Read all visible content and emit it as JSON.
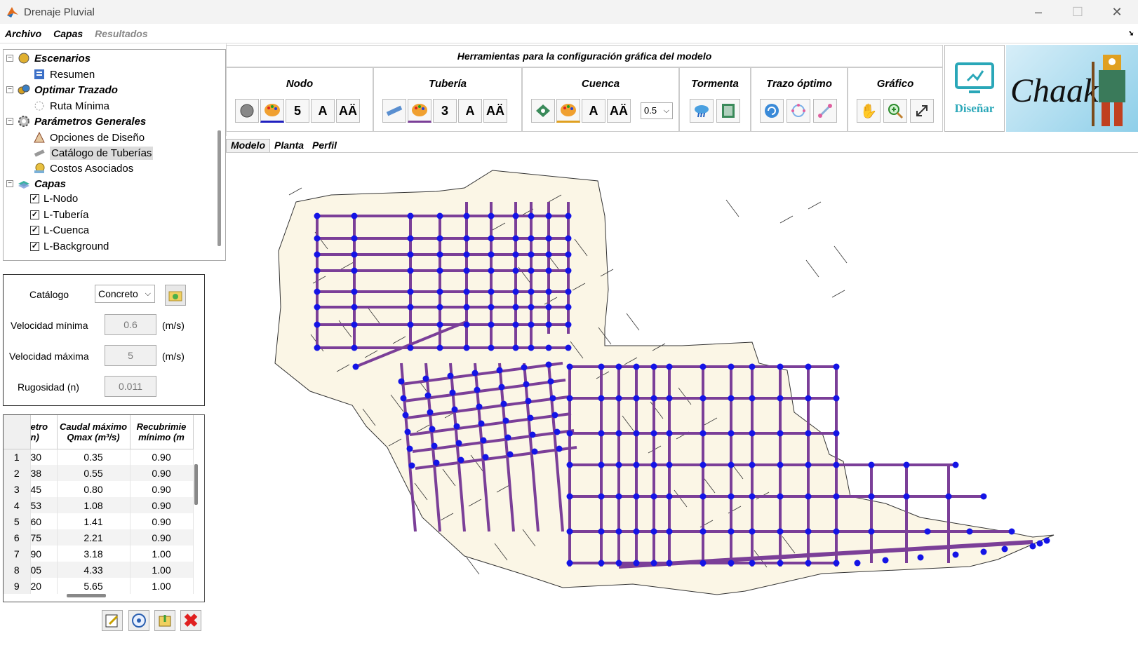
{
  "window": {
    "title": "Drenaje Pluvial",
    "minimize": "–",
    "maximize": "☐",
    "close": "✕"
  },
  "menu": [
    "Archivo",
    "Capas",
    "Resultados"
  ],
  "tree": {
    "escenarios": "Escenarios",
    "resumen": "Resumen",
    "optimar": "Optimar Trazado",
    "ruta": "Ruta Mínima",
    "parametros": "Parámetros Generales",
    "opciones": "Opciones de Diseño",
    "catalogo": "Catálogo de Tuberías",
    "costos": "Costos Asociados",
    "capas": "Capas",
    "layers": [
      {
        "label": "L-Nodo",
        "checked": true
      },
      {
        "label": "L-Tubería",
        "checked": true
      },
      {
        "label": "L-Cuenca",
        "checked": true
      },
      {
        "label": "L-Background",
        "checked": true
      }
    ]
  },
  "params": {
    "catalogo_label": "Catálogo",
    "catalogo_value": "Concreto",
    "vmin_label": "Velocidad mínima",
    "vmin_value": "0.6",
    "vmin_unit": "(m/s)",
    "vmax_label": "Velocidad máxima",
    "vmax_value": "5",
    "vmax_unit": "(m/s)",
    "rug_label": "Rugosidad (n)",
    "rug_value": "0.011"
  },
  "table": {
    "headers": [
      "etro\nn)",
      "Caudal máximo\nQmax (m³/s)",
      "Recubrimie\nmínimo (m"
    ],
    "rows": [
      [
        "1",
        "30",
        "0.35",
        "0.90"
      ],
      [
        "2",
        "38",
        "0.55",
        "0.90"
      ],
      [
        "3",
        "45",
        "0.80",
        "0.90"
      ],
      [
        "4",
        "53",
        "1.08",
        "0.90"
      ],
      [
        "5",
        "60",
        "1.41",
        "0.90"
      ],
      [
        "6",
        "75",
        "2.21",
        "0.90"
      ],
      [
        "7",
        "90",
        "3.18",
        "1.00"
      ],
      [
        "8",
        "05",
        "4.33",
        "1.00"
      ],
      [
        "9",
        "20",
        "5.65",
        "1.00"
      ]
    ]
  },
  "toolbar": {
    "header": "Herramientas para la configuración gráfica del modelo",
    "groups": {
      "nodo": "Nodo",
      "tuberia": "Tubería",
      "cuenca": "Cuenca",
      "tormenta": "Tormenta",
      "trazo": "Trazo óptimo",
      "grafico": "Gráfico"
    },
    "nodo_size": "5",
    "tuberia_size": "3",
    "cuenca_dd": "0.5",
    "font_a": "A",
    "font_aa": "AÄ"
  },
  "disenar": "Diseñar",
  "logo": "Chaak",
  "tabs": [
    "Modelo",
    "Planta",
    "Perfil"
  ],
  "colors": {
    "pipe": "#7b3f98",
    "node": "#1414e6",
    "basin": "#fbf6e6"
  }
}
